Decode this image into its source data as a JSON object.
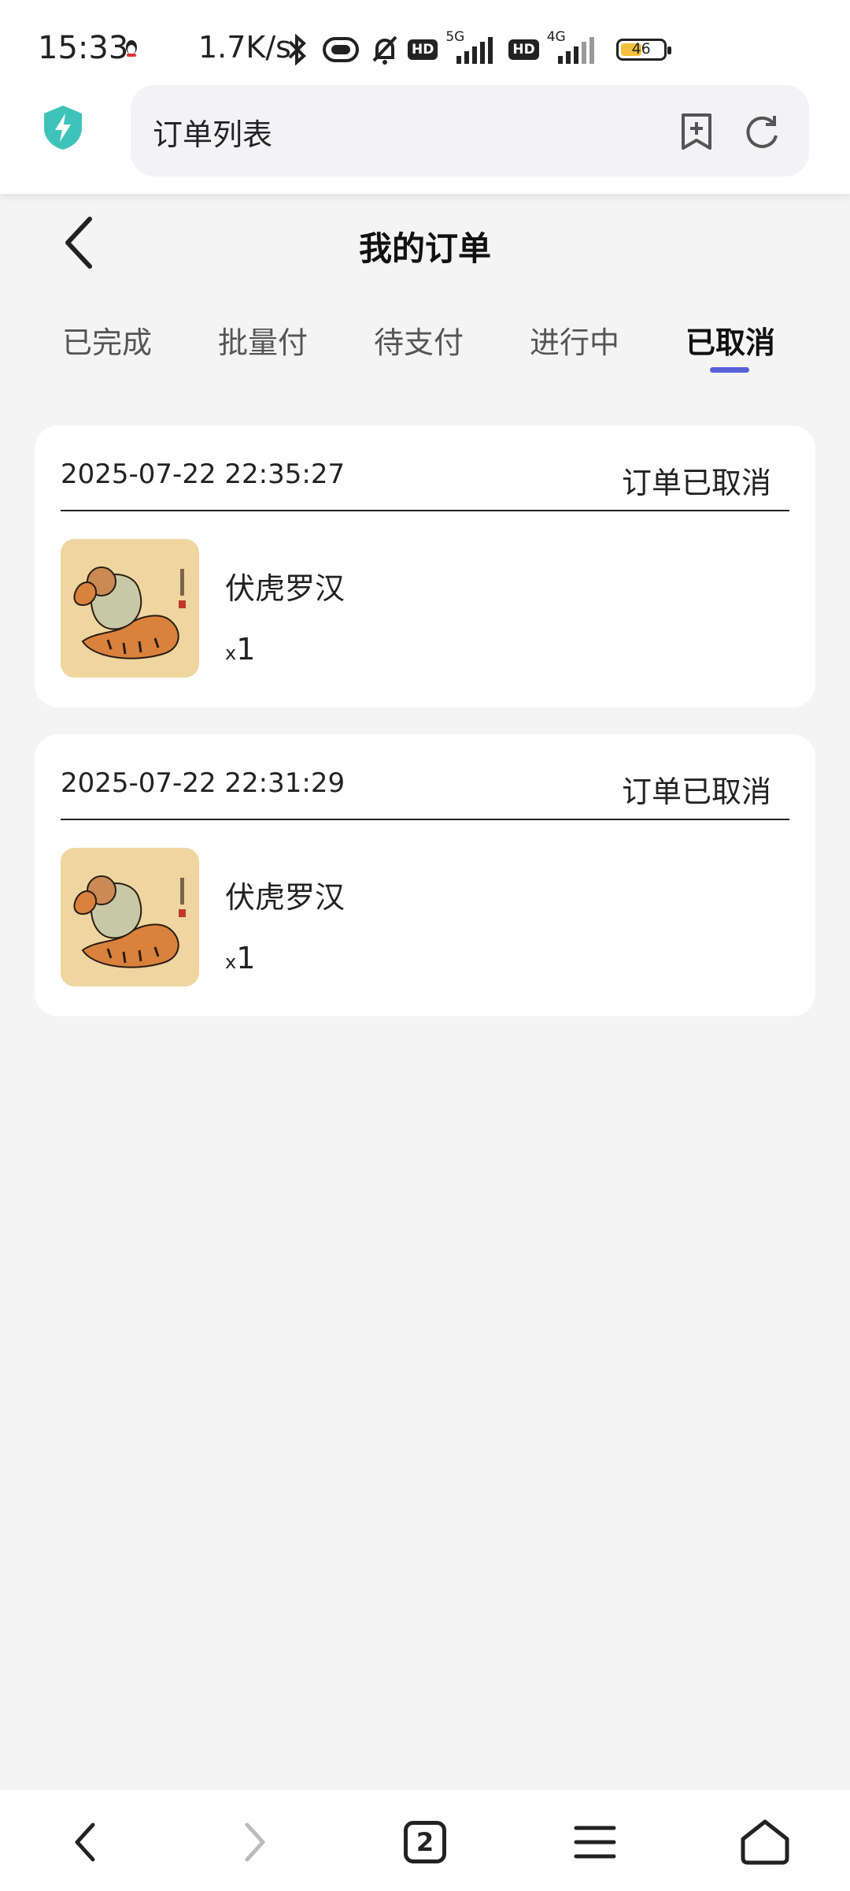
{
  "status_bar": {
    "time": "15:33",
    "net_speed": "1.7K/s",
    "hd_label": "HD",
    "net1": "5G",
    "net2": "4G",
    "battery": "46",
    "colors": {
      "battery_fill": "#f2c03a"
    }
  },
  "browser": {
    "address_text": "订单列表",
    "tab_count": "2",
    "icons": [
      "shield-icon",
      "add-bookmark-icon",
      "refresh-icon",
      "back-icon",
      "forward-icon",
      "tabs-icon",
      "menu-icon",
      "home-icon"
    ],
    "colors": {
      "shield": "#3fc3b8"
    }
  },
  "page": {
    "title": "我的订单",
    "tabs": [
      {
        "label": "已完成"
      },
      {
        "label": "批量付"
      },
      {
        "label": "待支付"
      },
      {
        "label": "进行中"
      },
      {
        "label": "已取消",
        "active": true
      }
    ],
    "accent_color": "#5661d8"
  },
  "orders": [
    {
      "date": "2025-07-22 22:35:27",
      "status": "订单已取消",
      "product_name": "伏虎罗汉",
      "qty_prefix": "x",
      "qty": "1"
    },
    {
      "date": "2025-07-22 22:31:29",
      "status": "订单已取消",
      "product_name": "伏虎罗汉",
      "qty_prefix": "x",
      "qty": "1"
    }
  ]
}
